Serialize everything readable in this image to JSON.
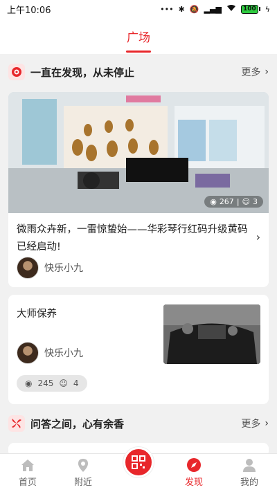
{
  "status": {
    "time": "上午10:06",
    "battery": "100"
  },
  "header": {
    "title": "广场"
  },
  "section1": {
    "title": "一直在发现，从未停止",
    "more": "更多"
  },
  "card1": {
    "views": "267",
    "comments": "3",
    "title": "微雨众卉新，一雷惊蛰始——华彩琴行红码升级黄码已经启动!",
    "author": "快乐小九"
  },
  "card2": {
    "title": "大师保养",
    "author": "快乐小九",
    "views": "245",
    "comments": "4"
  },
  "section2": {
    "title": "问答之间，心有余香",
    "more": "更多"
  },
  "tabbar": {
    "items": [
      {
        "label": "首页",
        "icon": "home-icon"
      },
      {
        "label": "附近",
        "icon": "location-icon"
      },
      {
        "label": "",
        "icon": "scan-icon"
      },
      {
        "label": "发现",
        "icon": "compass-icon",
        "active": true
      },
      {
        "label": "我的",
        "icon": "person-icon"
      }
    ]
  },
  "colors": {
    "accent": "#e8272b"
  }
}
